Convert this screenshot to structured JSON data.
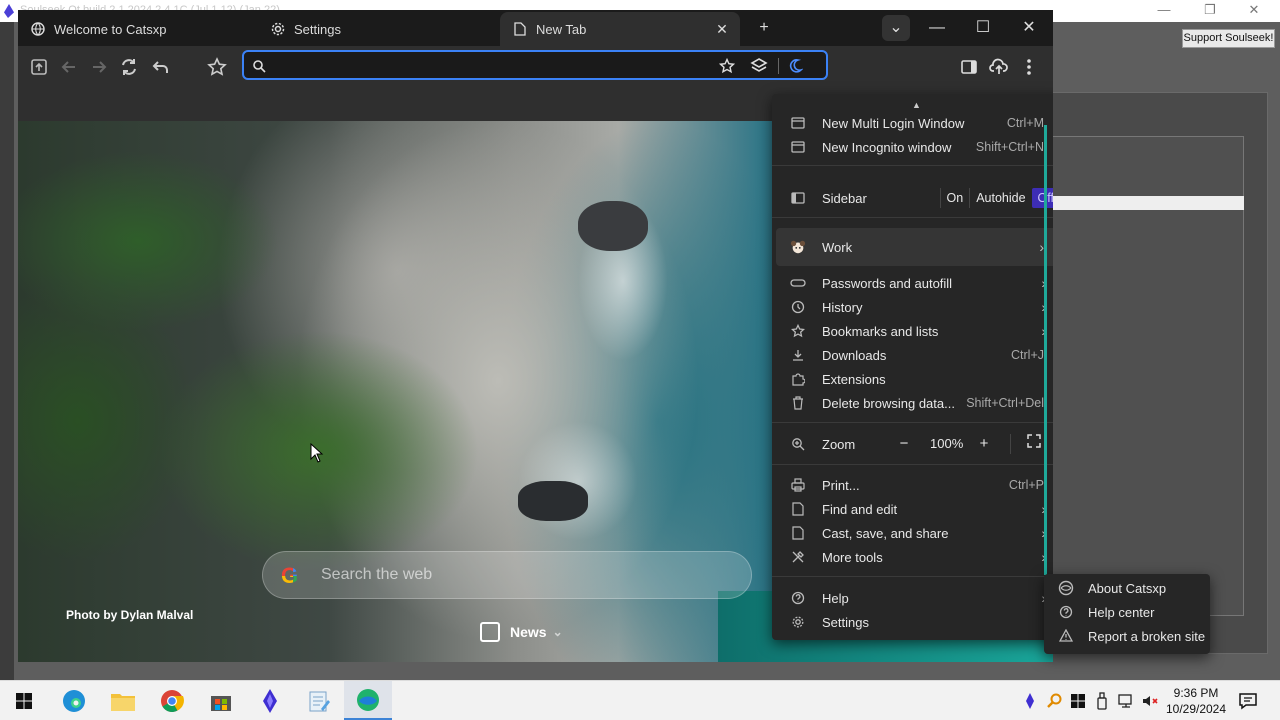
{
  "background_app": {
    "title": "Soulseek Qt build 2.1.2024.2.4.1C (Jul 1 12) (Jan 22)",
    "support_button": "Support Soulseek!"
  },
  "browser": {
    "tabs": [
      {
        "label": "Welcome to Catsxp",
        "icon": "globe-icon",
        "active": false
      },
      {
        "label": "Settings",
        "icon": "gear-icon",
        "active": false
      },
      {
        "label": "New Tab",
        "icon": "page-icon",
        "active": true
      }
    ],
    "new_tab_symbol": "+",
    "omnibox": {
      "value": "",
      "placeholder": ""
    },
    "photo_credit": "Photo by Dylan Malval",
    "search_placeholder": "Search the web",
    "news_label": "News"
  },
  "menu": {
    "items": {
      "new_multi_login": {
        "label": "New Multi Login Window",
        "shortcut": "Ctrl+M"
      },
      "new_incognito": {
        "label": "New Incognito window",
        "shortcut": "Shift+Ctrl+N"
      },
      "sidebar": {
        "label": "Sidebar",
        "options": [
          "On",
          "Autohide",
          "Off"
        ],
        "selected": "Off"
      },
      "work": {
        "label": "Work"
      },
      "passwords": {
        "label": "Passwords and autofill"
      },
      "history": {
        "label": "History"
      },
      "bookmarks": {
        "label": "Bookmarks and lists"
      },
      "downloads": {
        "label": "Downloads",
        "shortcut": "Ctrl+J"
      },
      "extensions": {
        "label": "Extensions"
      },
      "delete_data": {
        "label": "Delete browsing data...",
        "shortcut": "Shift+Ctrl+Del"
      },
      "zoom": {
        "label": "Zoom",
        "minus": "−",
        "value": "100%",
        "plus": "+"
      },
      "print": {
        "label": "Print...",
        "shortcut": "Ctrl+P"
      },
      "find_edit": {
        "label": "Find and edit"
      },
      "cast_save": {
        "label": "Cast, save, and share"
      },
      "more_tools": {
        "label": "More tools"
      },
      "help": {
        "label": "Help"
      },
      "settings": {
        "label": "Settings"
      }
    }
  },
  "help_submenu": {
    "items": [
      {
        "label": "About Catsxp",
        "icon": "catsxp-logo-icon"
      },
      {
        "label": "Help center",
        "icon": "question-icon"
      },
      {
        "label": "Report a broken site",
        "icon": "warning-icon"
      }
    ]
  },
  "taskbar": {
    "time": "9:36 PM",
    "date": "10/29/2024",
    "accent": "#3b82d6"
  }
}
